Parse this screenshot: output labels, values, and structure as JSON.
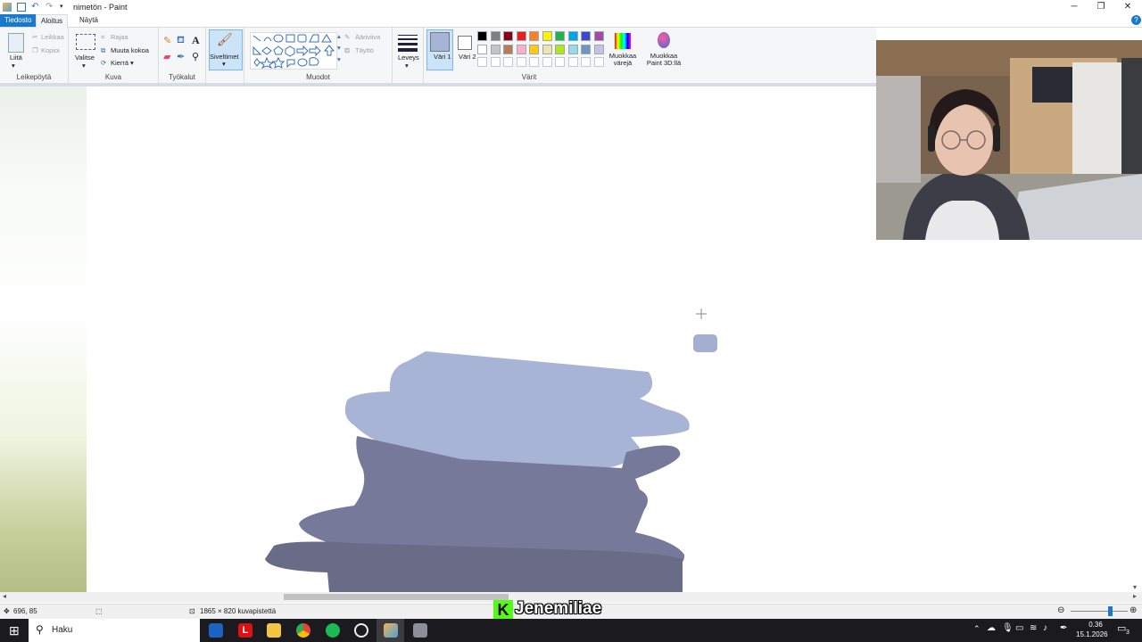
{
  "app": {
    "title": "nimetön - Paint",
    "tabs": [
      "Tiedosto",
      "Aloitus",
      "Näytä"
    ]
  },
  "ribbon": {
    "clipboard": {
      "paste": "Liitä",
      "cut": "Leikkaa",
      "copy": "Kopioi",
      "label": "Leikepöytä"
    },
    "image": {
      "select": "Valitse",
      "crop": "Rajaa",
      "resize": "Muuta kokoa",
      "rotate": "Kierrä",
      "label": "Kuva"
    },
    "tools": {
      "label": "Työkalut"
    },
    "brushes": {
      "label": "Siveltimet"
    },
    "shapes": {
      "outline": "Ääriviiva",
      "fill": "Täyttö",
      "label": "Muodot"
    },
    "size": {
      "label": "Leveys"
    },
    "colors": {
      "color1": "Väri 1",
      "color2": "Väri 2",
      "edit": "Muokkaa värejä",
      "paint3d": "Muokkaa Paint 3D:llä",
      "label": "Värit",
      "color1_value": "#a6b4d8",
      "color2_value": "#ffffff",
      "palette_row1": [
        "#000000",
        "#7f7f7f",
        "#880015",
        "#ed1c24",
        "#ff7f27",
        "#fff200",
        "#22b14c",
        "#00a2e8",
        "#3f48cc",
        "#a349a4"
      ],
      "palette_row2": [
        "#ffffff",
        "#c3c3c3",
        "#b97a57",
        "#ffaec9",
        "#ffc90e",
        "#efe4b0",
        "#b5e61d",
        "#99d9ea",
        "#7092be",
        "#c8bfe7"
      ]
    }
  },
  "status": {
    "cursor_pos": "696, 85",
    "canvas_size": "1865 × 820 kuvapistettä"
  },
  "overlay": {
    "streamer_name": "Jenemiliae"
  },
  "taskbar": {
    "search": "Haku",
    "time": "0.36",
    "date": "15.1.2026",
    "notifications": "3"
  }
}
